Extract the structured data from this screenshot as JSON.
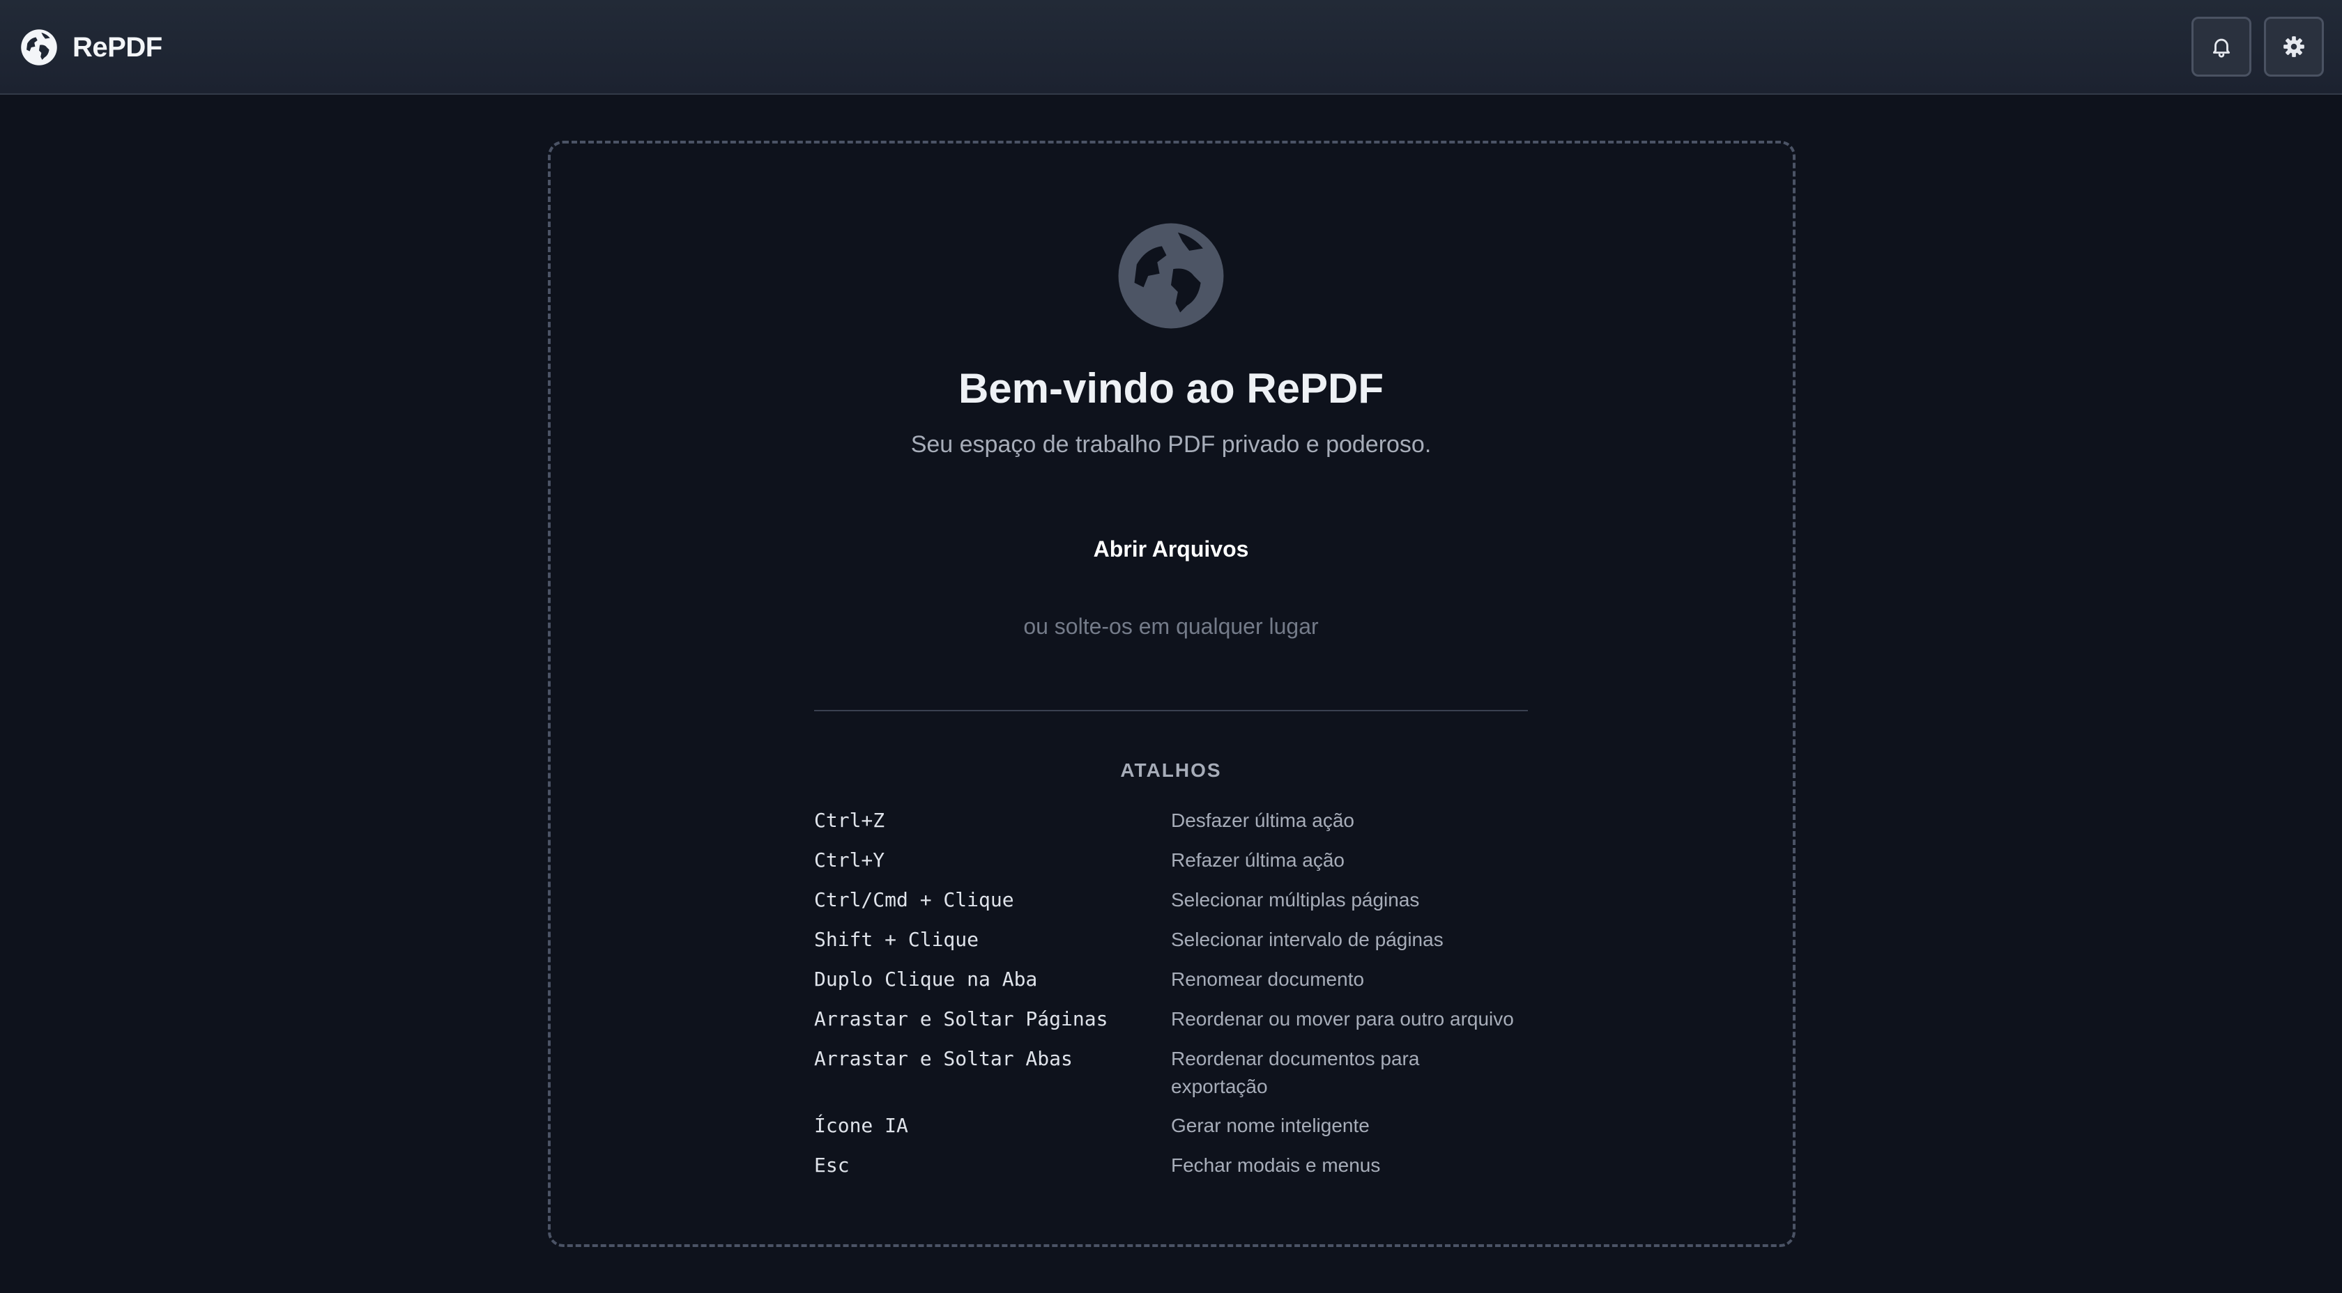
{
  "app": {
    "name": "RePDF",
    "logo_icon": "globe-icon"
  },
  "header": {
    "notifications_icon": "bell-icon",
    "settings_icon": "gear-icon"
  },
  "welcome": {
    "icon": "globe-icon",
    "title": "Bem-vindo ao RePDF",
    "subtitle": "Seu espaço de trabalho PDF privado e poderoso.",
    "open_button_label": "Abrir Arquivos",
    "drop_hint": "ou solte-os em qualquer lugar"
  },
  "shortcuts": {
    "heading": "ATALHOS",
    "items": [
      {
        "key": "Ctrl+Z",
        "description": "Desfazer última ação"
      },
      {
        "key": "Ctrl+Y",
        "description": "Refazer última ação"
      },
      {
        "key": "Ctrl/Cmd + Clique",
        "description": "Selecionar múltiplas páginas"
      },
      {
        "key": "Shift + Clique",
        "description": "Selecionar intervalo de páginas"
      },
      {
        "key": "Duplo Clique na Aba",
        "description": "Renomear documento"
      },
      {
        "key": "Arrastar e Soltar Páginas",
        "description": "Reordenar ou mover para outro arquivo"
      },
      {
        "key": "Arrastar e Soltar Abas",
        "description": "Reordenar documentos para exportação"
      },
      {
        "key": "Ícone IA",
        "description": "Gerar nome inteligente"
      },
      {
        "key": "Esc",
        "description": "Fechar modais e menus"
      }
    ]
  },
  "colors": {
    "background": "#0e121c",
    "header": "#1f2633",
    "icon_muted": "#4d5565",
    "text_primary": "#eef1f5",
    "text_secondary": "#a7adb9"
  }
}
